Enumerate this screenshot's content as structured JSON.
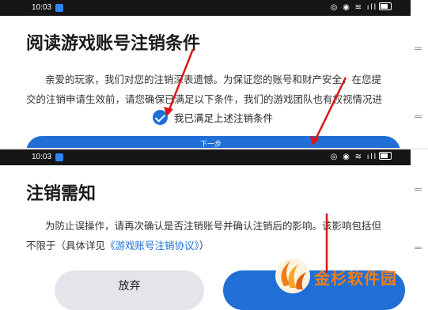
{
  "screen1": {
    "status_time": "10:03",
    "status_icons": "◎ ◉ ≋ ıll",
    "title": "阅读游戏账号注销条件",
    "paragraph_line1": "亲爱的玩家，我们对您的注销深表遗憾。为保证您的账号和财产安全，在您提",
    "paragraph_line2": "交的注销申请生效前，请您确保已满足以下条件，我们的游戏团队也有权视情况进",
    "confirm_label": "我已满足上述注销条件",
    "button_glyph": "下一步"
  },
  "screen2": {
    "status_time": "10:03",
    "status_icons": "◎ ◉ ≋ ıll",
    "title": "注销需知",
    "paragraph_line1": "为防止误操作，请再次确认是否注销账号并确认注销后的影响。该影响包括但",
    "paragraph_prefix": "不限于（具体详见",
    "agreement_link": "《游戏账号注销协议》",
    "paragraph_suffix": "）",
    "cancel_label": "放弃"
  },
  "watermark": {
    "text": "金杉软件园"
  },
  "colors": {
    "accent": "#1f6fd6",
    "annotation": "#d81818",
    "watermark": "#f07d18"
  }
}
